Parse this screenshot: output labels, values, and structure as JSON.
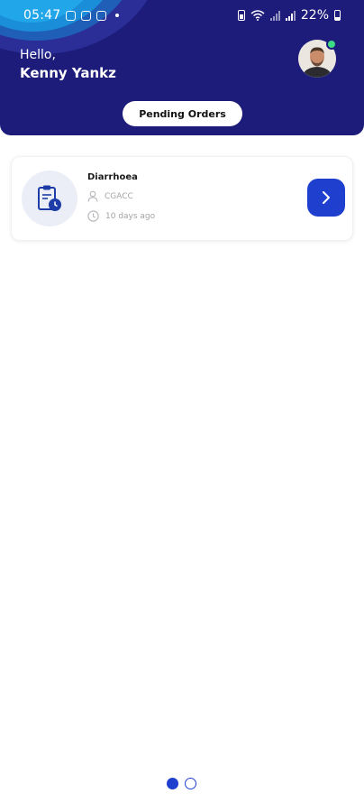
{
  "status_bar": {
    "time": "05:47",
    "battery_percent": "22%"
  },
  "header": {
    "greeting": "Hello,",
    "user_name": "Kenny Yankz",
    "pending_button_label": "Pending Orders",
    "avatar_online": true
  },
  "orders": [
    {
      "title": "Diarrhoea",
      "provider": "CGACC",
      "time_ago": "10 days ago"
    }
  ],
  "pager": {
    "total": 2,
    "active_index": 0
  },
  "colors": {
    "header_bg": "#1d1c7a",
    "accent": "#1f3fcf",
    "online": "#3ddc84"
  }
}
